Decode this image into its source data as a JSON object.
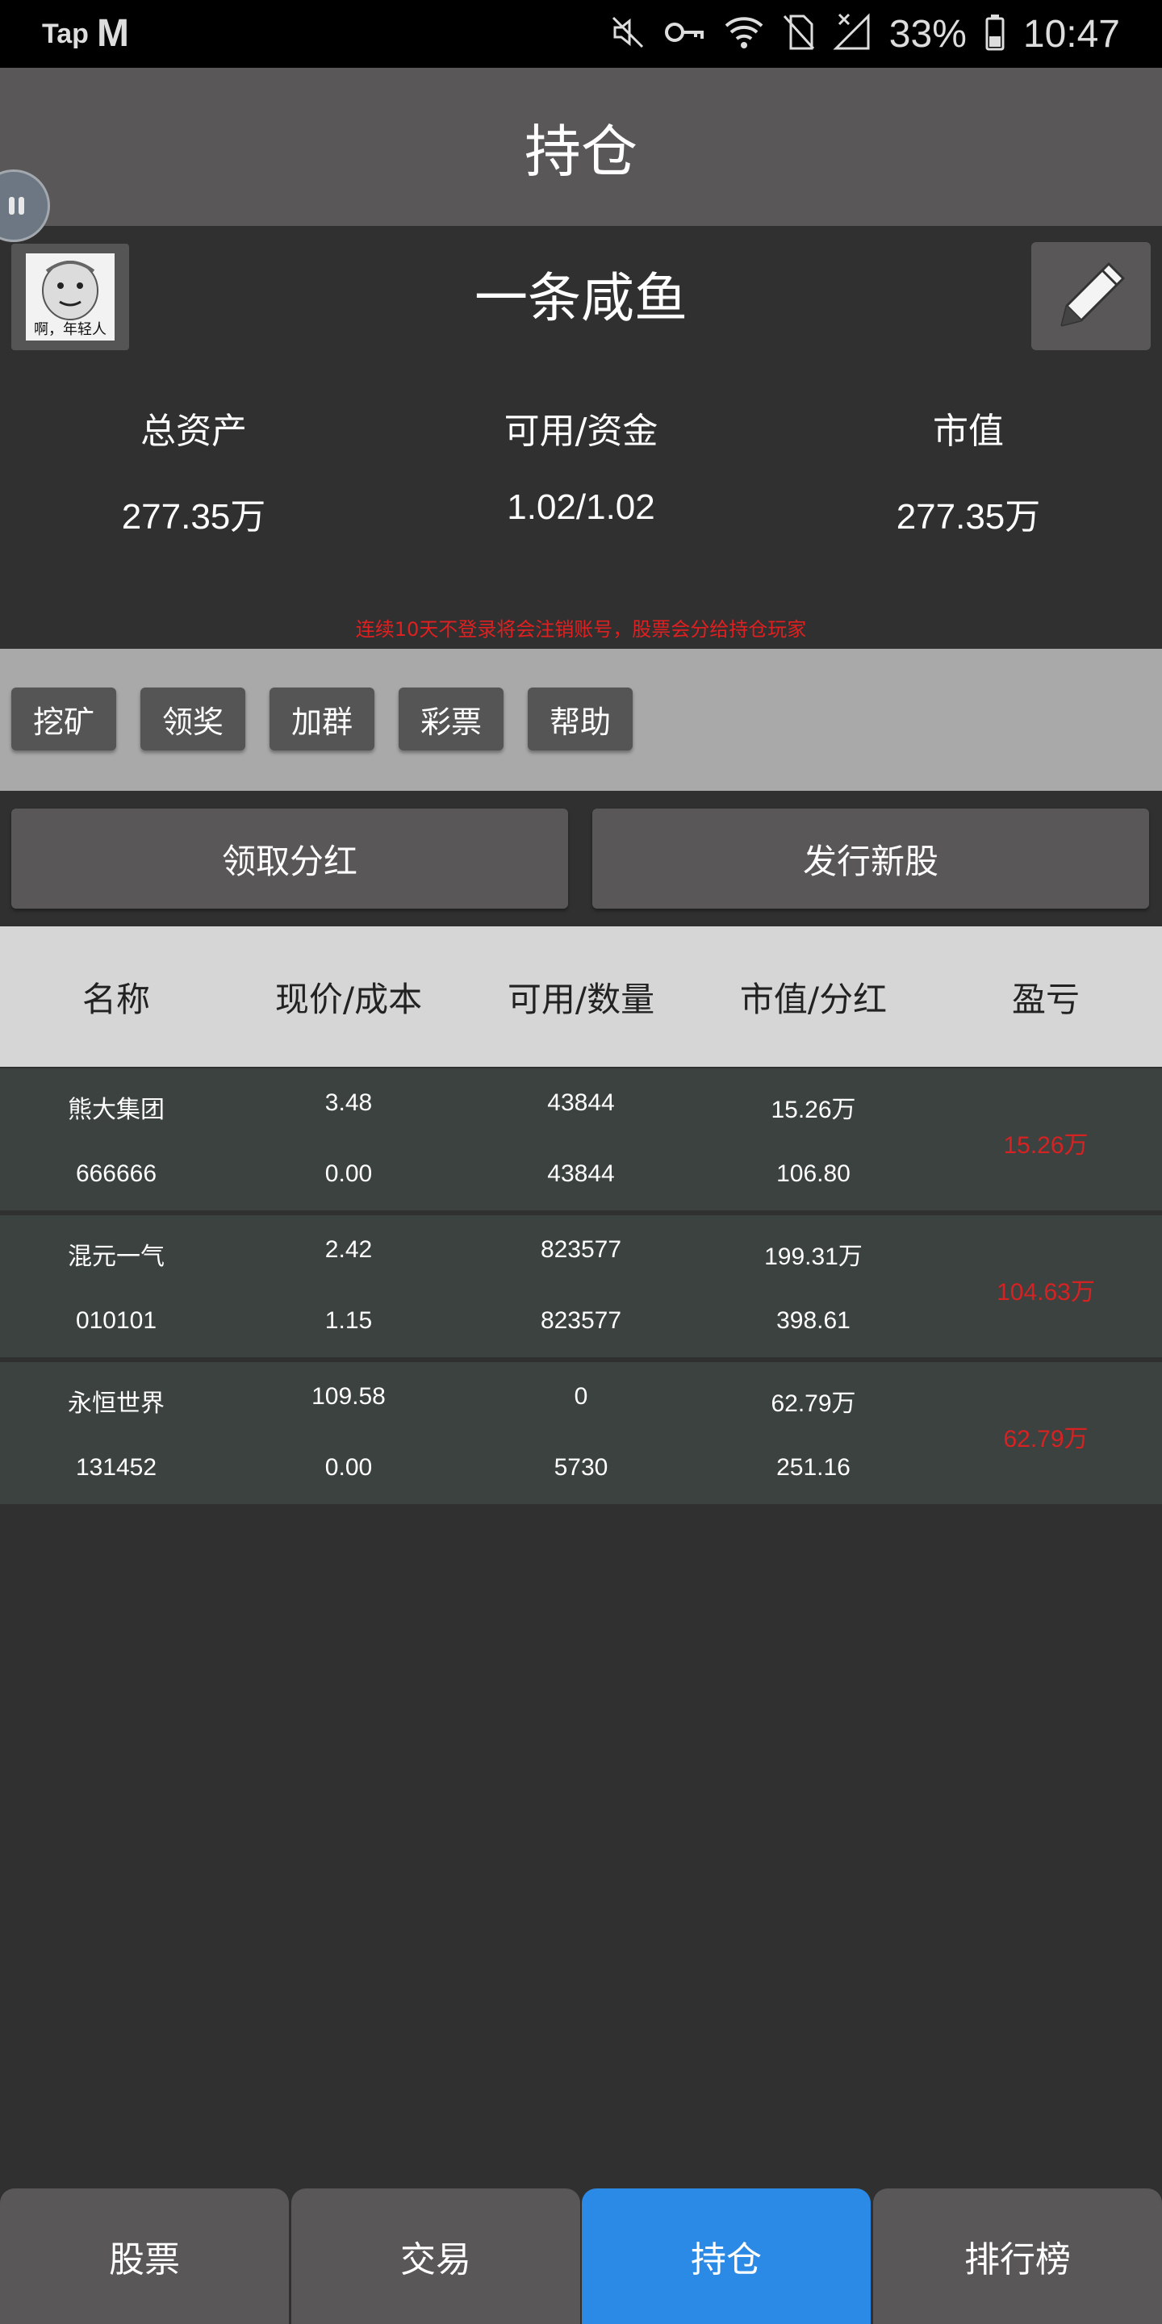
{
  "status_bar": {
    "tap_text": "Tap",
    "logo_letter": "M",
    "battery": "33%",
    "time": "10:47",
    "icons": [
      "mute-icon",
      "vpn-key-icon",
      "wifi-icon",
      "no-sim-icon",
      "signal-icon",
      "battery-icon"
    ]
  },
  "header": {
    "title": "持仓"
  },
  "profile": {
    "avatar_caption": "啊，年轻人",
    "username": "一条咸鱼"
  },
  "stats": [
    {
      "label": "总资产",
      "value": "277.35万"
    },
    {
      "label": "可用/资金",
      "value": "1.02/1.02"
    },
    {
      "label": "市值",
      "value": "277.35万"
    }
  ],
  "notice": "连续10天不登录将会注销账号，股票会分给持仓玩家",
  "quick_actions": [
    "挖矿",
    "领奖",
    "加群",
    "彩票",
    "帮助"
  ],
  "buttons": {
    "dividend": "领取分红",
    "issue": "发行新股"
  },
  "table": {
    "headers": [
      "名称",
      "现价/成本",
      "可用/数量",
      "市值/分红",
      "盈亏"
    ],
    "rows": [
      {
        "name": "熊大集团",
        "code": "666666",
        "price": "3.48",
        "cost": "0.00",
        "available": "43844",
        "quantity": "43844",
        "market_value": "15.26万",
        "dividend": "106.80",
        "pnl": "15.26万"
      },
      {
        "name": "混元一气",
        "code": "010101",
        "price": "2.42",
        "cost": "1.15",
        "available": "823577",
        "quantity": "823577",
        "market_value": "199.31万",
        "dividend": "398.61",
        "pnl": "104.63万"
      },
      {
        "name": "永恒世界",
        "code": "131452",
        "price": "109.58",
        "cost": "0.00",
        "available": "0",
        "quantity": "5730",
        "market_value": "62.79万",
        "dividend": "251.16",
        "pnl": "62.79万"
      }
    ]
  },
  "bottom_nav": [
    {
      "label": "股票",
      "active": false
    },
    {
      "label": "交易",
      "active": false
    },
    {
      "label": "持仓",
      "active": true
    },
    {
      "label": "排行榜",
      "active": false
    }
  ],
  "colors": {
    "active_tab": "#2a8ae6",
    "loss_profit_text": "#d62222",
    "header_bg": "#595757"
  }
}
